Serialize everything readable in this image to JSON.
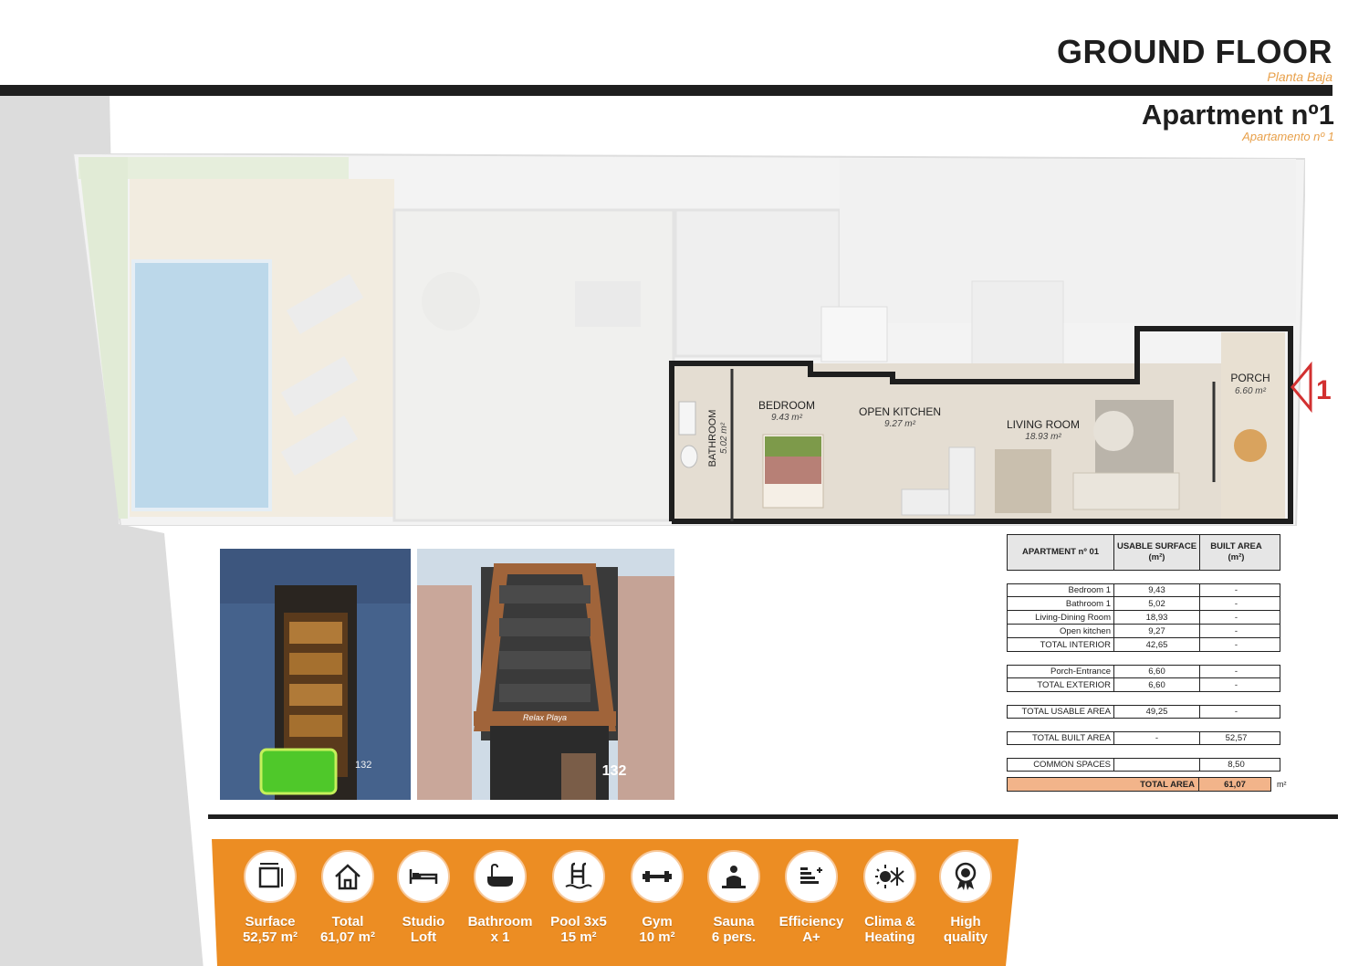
{
  "header": {
    "floor_title": "GROUND FLOOR",
    "floor_subtitle": "Planta Baja",
    "apartment_title": "Apartment nº1",
    "apartment_subtitle": "Apartamento nº 1"
  },
  "plan": {
    "rooms": [
      {
        "name": "BEDROOM",
        "area": "9.43 m²"
      },
      {
        "name": "OPEN KITCHEN",
        "area": "9.27 m²"
      },
      {
        "name": "LIVING ROOM",
        "area": "18.93 m²"
      },
      {
        "name": "PORCH",
        "area": "6.60 m²"
      },
      {
        "name": "BATHROOM",
        "area": "5.02 m²"
      }
    ],
    "entrance_marker": "1"
  },
  "photos": {
    "building_number": "132",
    "sign_text": "Relax Playa"
  },
  "area_table": {
    "headers": [
      "APARTMENT nº 01",
      "USABLE SURFACE (m²)",
      "BUILT AREA (m²)"
    ],
    "interior_rows": [
      [
        "Bedroom 1",
        "9,43",
        "-"
      ],
      [
        "Bathroom 1",
        "5,02",
        "-"
      ],
      [
        "Living-Dining Room",
        "18,93",
        "-"
      ],
      [
        "Open kitchen",
        "9,27",
        "-"
      ],
      [
        "TOTAL INTERIOR",
        "42,65",
        "-"
      ]
    ],
    "exterior_rows": [
      [
        "Porch-Entrance",
        "6,60",
        "-"
      ],
      [
        "TOTAL EXTERIOR",
        "6,60",
        "-"
      ]
    ],
    "usable_row": [
      "TOTAL USABLE AREA",
      "49,25",
      "-"
    ],
    "built_row": [
      "TOTAL BUILT AREA",
      "-",
      "52,57"
    ],
    "common_row": [
      "COMMON SPACES",
      "",
      "8,50"
    ],
    "total_row": {
      "label": "TOTAL AREA",
      "value": "61,07",
      "unit": "m²"
    }
  },
  "features": [
    {
      "icon": "surface-icon",
      "line1": "Surface",
      "line2": "52,57 m²"
    },
    {
      "icon": "house-icon",
      "line1": "Total",
      "line2": "61,07 m²"
    },
    {
      "icon": "bed-icon",
      "line1": "Studio",
      "line2": "Loft"
    },
    {
      "icon": "bathtub-icon",
      "line1": "Bathroom",
      "line2": "x 1"
    },
    {
      "icon": "pool-icon",
      "line1": "Pool 3x5",
      "line2": "15 m²"
    },
    {
      "icon": "gym-icon",
      "line1": "Gym",
      "line2": "10 m²"
    },
    {
      "icon": "sauna-icon",
      "line1": "Sauna",
      "line2": "6 pers."
    },
    {
      "icon": "efficiency-icon",
      "line1": "Efficiency",
      "line2": "A+"
    },
    {
      "icon": "climate-icon",
      "line1": "Clima &",
      "line2": "Heating"
    },
    {
      "icon": "quality-icon",
      "line1": "High",
      "line2": "quality"
    }
  ],
  "colors": {
    "accent_orange": "#ec8d23",
    "subtitle_orange": "#e8a04a",
    "total_row_fill": "#f2b48a",
    "dark": "#1f1f1f"
  }
}
